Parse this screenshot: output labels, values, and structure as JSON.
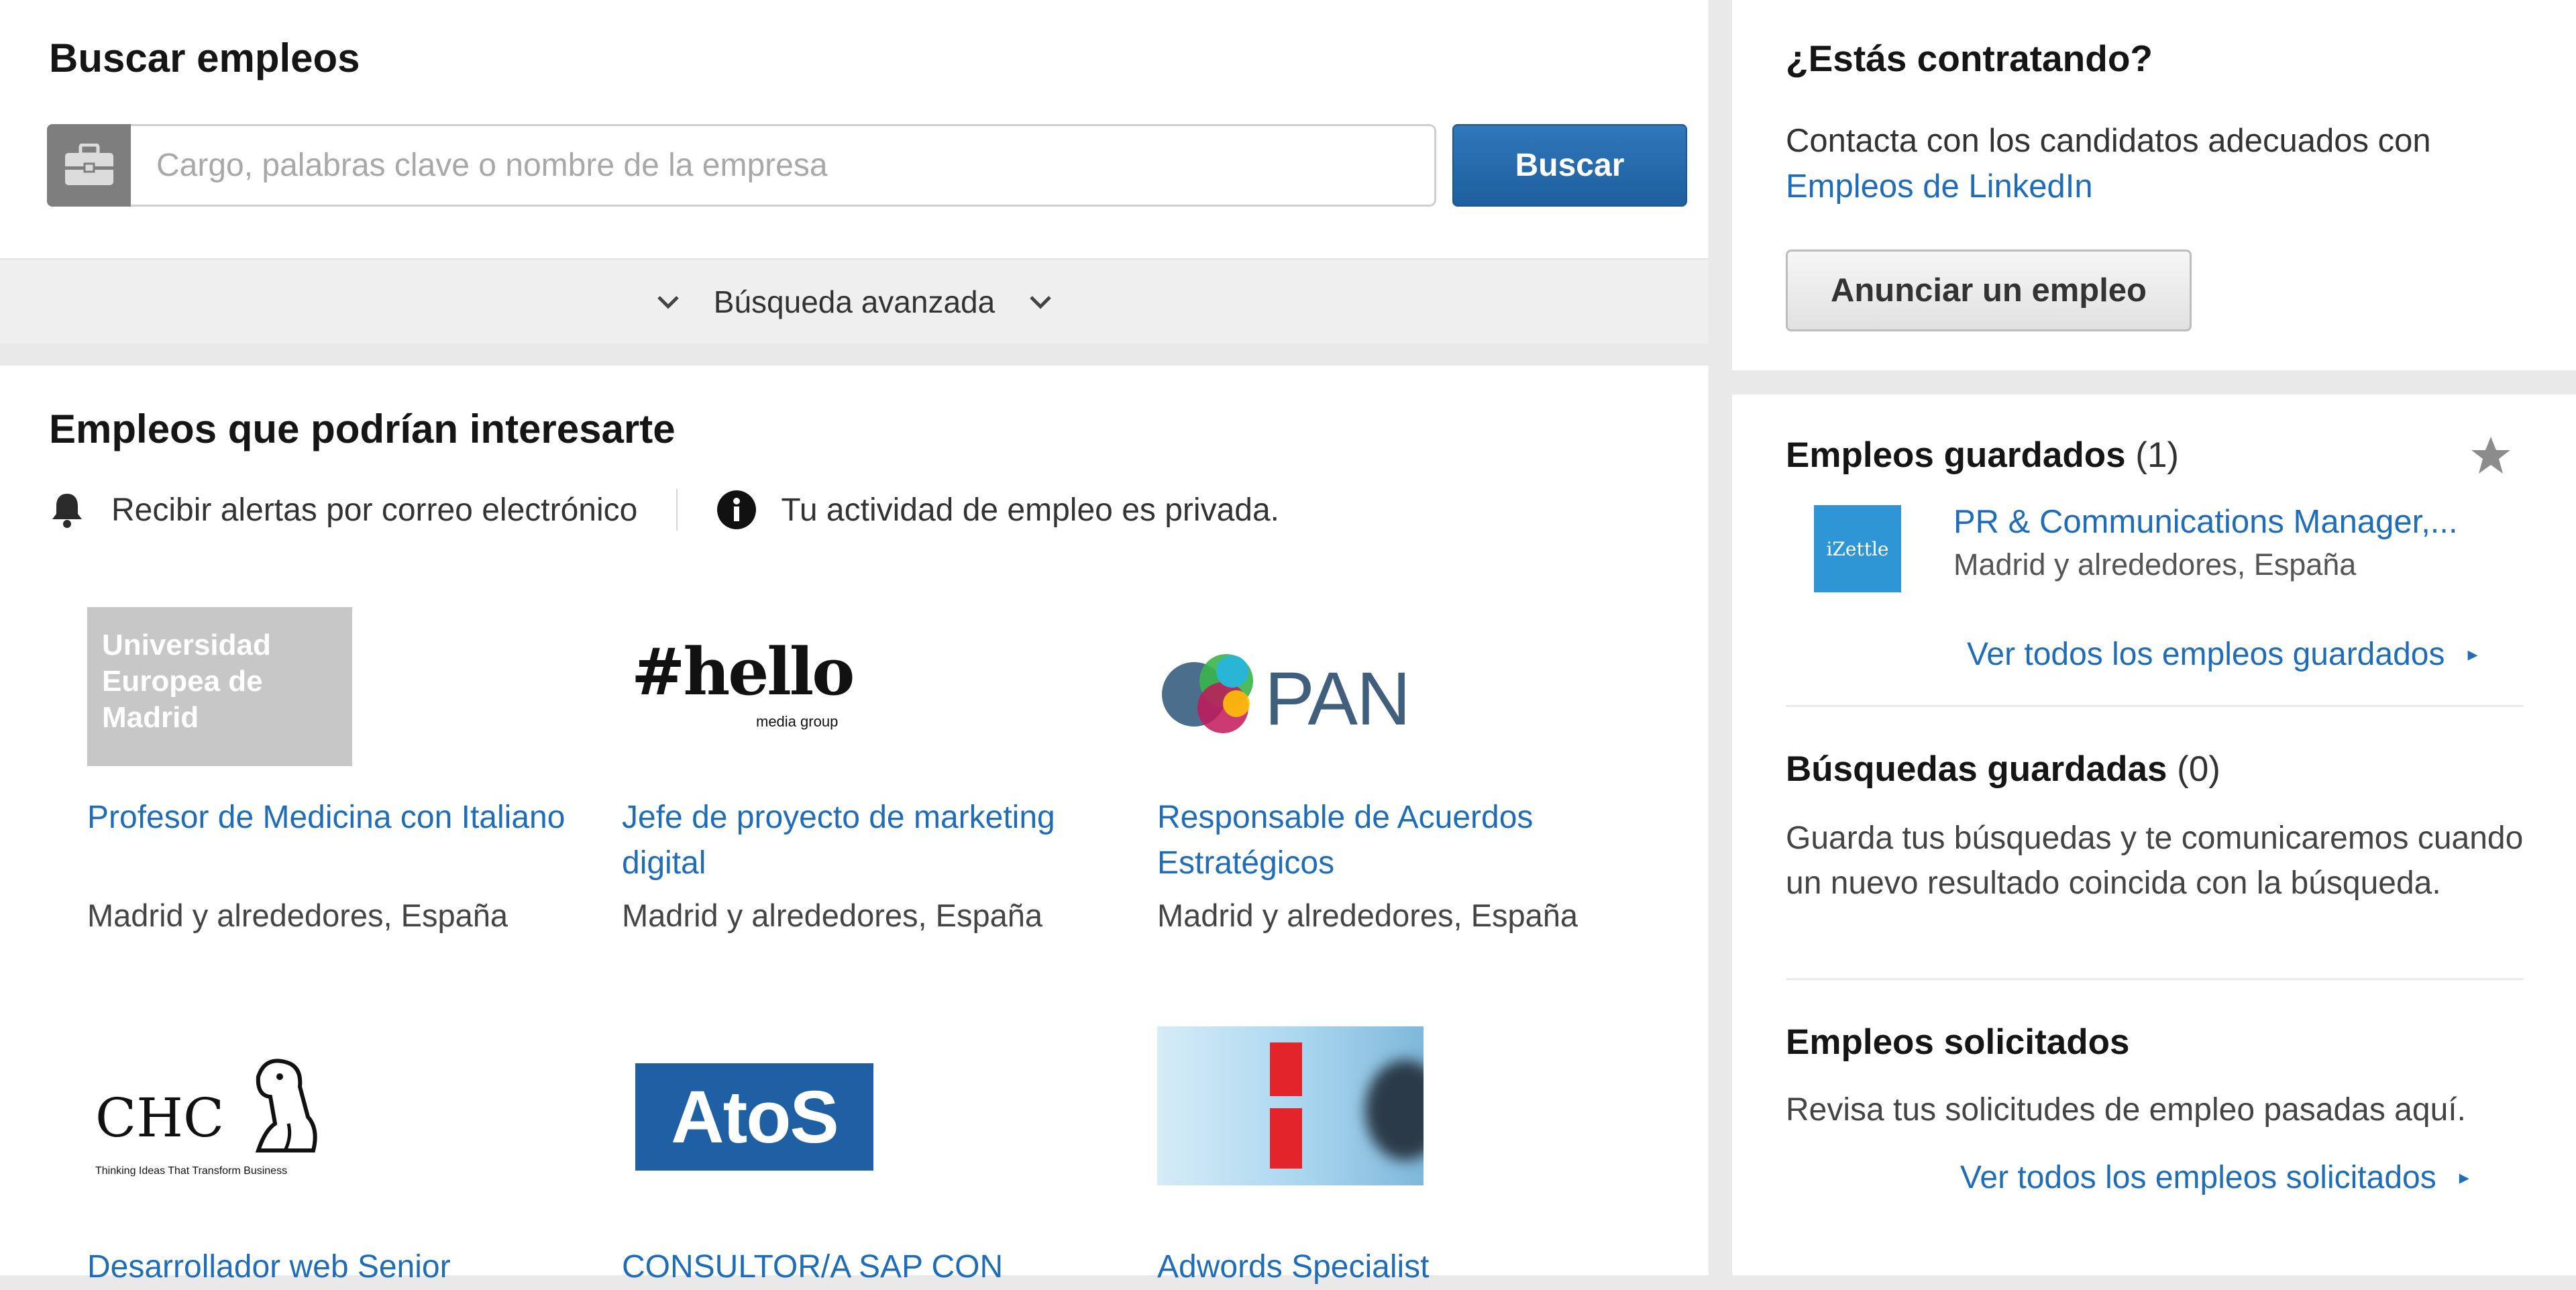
{
  "search": {
    "title": "Buscar empleos",
    "placeholder": "Cargo, palabras clave o nombre de la empresa",
    "button_label": "Buscar",
    "advanced_label": "Búsqueda avanzada"
  },
  "recommended": {
    "title": "Empleos que podrían interesarte",
    "alerts_label": "Recibir alertas por correo electrónico",
    "privacy_label": "Tu actividad de empleo es privada.",
    "jobs": [
      {
        "logo": "Universidad Europea de Madrid",
        "title": "Profesor de Medicina con Italiano",
        "location": "Madrid y alrededores, España"
      },
      {
        "logo": "#hello",
        "logo_sub": "media group",
        "title": "Jefe de proyecto de marketing digital",
        "location": "Madrid y alrededores, España"
      },
      {
        "logo": "PAN",
        "title": "Responsable de Acuerdos Estratégicos",
        "location": "Madrid y alrededores, España"
      },
      {
        "logo": "CHC",
        "logo_sub": "Thinking Ideas That Transform Business",
        "title": "Desarrollador web Senior",
        "location": ""
      },
      {
        "logo": "AtoS",
        "title": "CONSULTOR/A SAP CON",
        "location": ""
      },
      {
        "logo": "",
        "title": "Adwords Specialist",
        "location": ""
      }
    ]
  },
  "hiring": {
    "title": "¿Estás contratando?",
    "text": "Contacta con los candidatos adecuados con",
    "link": "Empleos de LinkedIn",
    "button_label": "Anunciar un empleo"
  },
  "saved_jobs": {
    "title": "Empleos guardados",
    "count": "(1)",
    "item_logo": "iZettle",
    "item_title": "PR & Communications Manager,...",
    "item_location": "Madrid y alrededores, España",
    "view_all": "Ver todos los empleos guardados"
  },
  "saved_searches": {
    "title": "Búsquedas guardadas",
    "count": "(0)",
    "text": "Guarda tus búsquedas y te comunicaremos cuando un nuevo resultado coincida con la búsqueda."
  },
  "applied_jobs": {
    "title": "Empleos solicitados",
    "text": "Revisa tus solicitudes de empleo pasadas aquí.",
    "view_all": "Ver todos los empleos solicitados"
  },
  "colors": {
    "link": "#1f6db8",
    "primary_button": "#1e5f9e",
    "page_bg": "#e9e9e9"
  },
  "icons": [
    "briefcase-icon",
    "chevron-down-icon",
    "bell-icon",
    "info-icon",
    "star-icon",
    "chevron-right-icon"
  ]
}
